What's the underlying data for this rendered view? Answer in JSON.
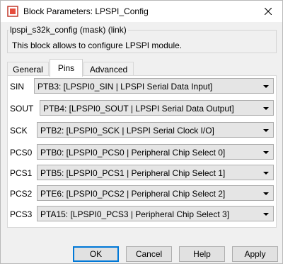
{
  "window": {
    "title": "Block Parameters: LPSPI_Config",
    "mask_label": "lpspi_s32k_config (mask) (link)",
    "description": "This block allows to configure LPSPI module."
  },
  "tabs": [
    {
      "label": "General"
    },
    {
      "label": "Pins",
      "active": true
    },
    {
      "label": "Advanced"
    }
  ],
  "pins": [
    {
      "label": "SIN",
      "value": "PTB3: [LPSPI0_SIN | LPSPI Serial Data Input]"
    },
    {
      "label": "SOUT",
      "value": "PTB4: [LPSPI0_SOUT | LPSPI Serial Data Output]"
    },
    {
      "label": "SCK",
      "value": "PTB2: [LPSPI0_SCK | LPSPI Serial Clock I/O]"
    },
    {
      "label": "PCS0",
      "value": "PTB0: [LPSPI0_PCS0 | Peripheral Chip Select 0]"
    },
    {
      "label": "PCS1",
      "value": "PTB5: [LPSPI0_PCS1 | Peripheral Chip Select 1]"
    },
    {
      "label": "PCS2",
      "value": "PTE6: [LPSPI0_PCS2 | Peripheral Chip Select 2]"
    },
    {
      "label": "PCS3",
      "value": "PTA15: [LPSPI0_PCS3 | Peripheral Chip Select 3]"
    }
  ],
  "buttons": {
    "ok": "OK",
    "cancel": "Cancel",
    "help": "Help",
    "apply": "Apply"
  },
  "colors": {
    "window_bg": "#f0f0f0",
    "panel_bg": "#ffffff",
    "combo_bg": "#e5e5e5",
    "default_button_border": "#0078d7"
  },
  "icons": {
    "app": "simulink-block-icon",
    "close": "close-icon",
    "dropdown": "chevron-down-icon"
  }
}
